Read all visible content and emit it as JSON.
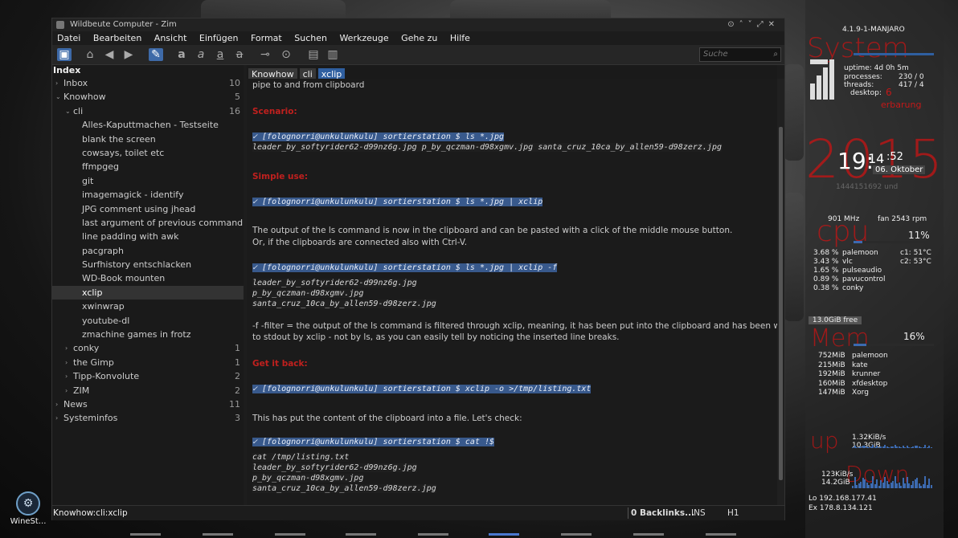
{
  "window": {
    "title": "Wildbeute Computer - Zim",
    "controls": [
      "⊙",
      "˄",
      "˅",
      "⤢",
      "✕"
    ]
  },
  "menu": [
    "Datei",
    "Bearbeiten",
    "Ansicht",
    "Einfügen",
    "Format",
    "Suchen",
    "Werkzeuge",
    "Gehe zu",
    "Hilfe"
  ],
  "toolbar": {
    "icons": [
      "notebook-icon",
      "home-icon",
      "back-icon",
      "forward-icon",
      "edit-icon",
      "bold-icon",
      "italic-icon",
      "underline-icon",
      "strike-icon",
      "link-icon",
      "attach-icon",
      "table-icon",
      "clipboard-icon"
    ],
    "search_placeholder": "Suche"
  },
  "sidebar": {
    "header": "Index",
    "nodes": [
      {
        "label": "Inbox",
        "count": "10",
        "level": 0,
        "arrow": "›"
      },
      {
        "label": "Knowhow",
        "count": "5",
        "level": 0,
        "arrow": "⌄"
      },
      {
        "label": "cli",
        "count": "16",
        "level": 1,
        "arrow": "⌄"
      },
      {
        "label": "Alles-Kaputtmachen - Testseite",
        "count": "",
        "level": 2,
        "arrow": ""
      },
      {
        "label": "blank the screen",
        "count": "",
        "level": 2,
        "arrow": ""
      },
      {
        "label": "cowsays, toilet etc",
        "count": "",
        "level": 2,
        "arrow": ""
      },
      {
        "label": "ffmpgeg",
        "count": "",
        "level": 2,
        "arrow": ""
      },
      {
        "label": "git",
        "count": "",
        "level": 2,
        "arrow": ""
      },
      {
        "label": "imagemagick - identify",
        "count": "",
        "level": 2,
        "arrow": ""
      },
      {
        "label": "JPG comment using jhead",
        "count": "",
        "level": 2,
        "arrow": ""
      },
      {
        "label": "last argument of previous command",
        "count": "",
        "level": 2,
        "arrow": ""
      },
      {
        "label": "line padding with awk",
        "count": "",
        "level": 2,
        "arrow": ""
      },
      {
        "label": "pacgraph",
        "count": "",
        "level": 2,
        "arrow": ""
      },
      {
        "label": "Surfhistory entschlacken",
        "count": "",
        "level": 2,
        "arrow": ""
      },
      {
        "label": "WD-Book mounten",
        "count": "",
        "level": 2,
        "arrow": ""
      },
      {
        "label": "xclip",
        "count": "",
        "level": 2,
        "arrow": "",
        "selected": true
      },
      {
        "label": "xwinwrap",
        "count": "",
        "level": 2,
        "arrow": ""
      },
      {
        "label": "youtube-dl",
        "count": "",
        "level": 2,
        "arrow": ""
      },
      {
        "label": "zmachine games in frotz",
        "count": "",
        "level": 2,
        "arrow": ""
      },
      {
        "label": "conky",
        "count": "1",
        "level": 1,
        "arrow": "›"
      },
      {
        "label": "the Gimp",
        "count": "1",
        "level": 1,
        "arrow": "›"
      },
      {
        "label": "Tipp-Konvolute",
        "count": "2",
        "level": 1,
        "arrow": "›"
      },
      {
        "label": "ZIM",
        "count": "2",
        "level": 1,
        "arrow": "›"
      },
      {
        "label": "News",
        "count": "11",
        "level": 0,
        "arrow": "›"
      },
      {
        "label": "Systeminfos",
        "count": "3",
        "level": 0,
        "arrow": "›"
      }
    ]
  },
  "pathbar": [
    "Knowhow",
    "cli",
    "xclip"
  ],
  "editor": {
    "lines": [
      {
        "kind": "text",
        "text": "pipe to and from clipboard"
      },
      {
        "kind": "head",
        "text": "Scenario:"
      },
      {
        "kind": "cmd",
        "text": "✓ [folognorri@unkulunkulu]  sortierstation $ ls *.jpg"
      },
      {
        "kind": "out",
        "text": "leader_by_softyrider62-d99nz6g.jpg  p_by_qczman-d98xgmv.jpg  santa_cruz_10ca_by_allen59-d98zerz.jpg"
      },
      {
        "kind": "head",
        "text": "Simple use:"
      },
      {
        "kind": "cmd",
        "text": "✓ [folognorri@unkulunkulu]  sortierstation $ ls *.jpg | xclip"
      },
      {
        "kind": "text",
        "text": "The output of the ls command is now in the clipboard and can be pasted with a click of the middle mouse button."
      },
      {
        "kind": "text",
        "text": "Or, if the clipboards are connected also with Ctrl-V."
      },
      {
        "kind": "cmd",
        "text": "✓ [folognorri@unkulunkulu]  sortierstation $ ls *.jpg | xclip -f"
      },
      {
        "kind": "out",
        "text": "leader_by_softyrider62-d99nz6g.jpg"
      },
      {
        "kind": "out",
        "text": "p_by_qczman-d98xgmv.jpg"
      },
      {
        "kind": "out",
        "text": "santa_cruz_10ca_by_allen59-d98zerz.jpg"
      },
      {
        "kind": "text",
        "text": "-f  -filter = the output of the ls command is filtered through xclip, meaning, it has been put into the clipboard and has been written"
      },
      {
        "kind": "text",
        "text": "to stdout by xclip - not by ls, as you can easily tell by noticing the inserted line breaks."
      },
      {
        "kind": "head",
        "text": "Get it back:"
      },
      {
        "kind": "cmd",
        "text": "✓ [folognorri@unkulunkulu]  sortierstation $ xclip -o >/tmp/listing.txt"
      },
      {
        "kind": "text",
        "text": "This has put the content of the clipboard into a file. Let's check:"
      },
      {
        "kind": "cmd",
        "text": "✓ [folognorri@unkulunkulu]  sortierstation $ cat !$"
      },
      {
        "kind": "out",
        "text": "cat /tmp/listing.txt"
      },
      {
        "kind": "out",
        "text": "leader_by_softyrider62-d99nz6g.jpg"
      },
      {
        "kind": "out",
        "text": "p_by_qczman-d98xgmv.jpg"
      },
      {
        "kind": "out",
        "text": "santa_cruz_10ca_by_allen59-d98zerz.jpg"
      }
    ]
  },
  "statusbar": {
    "path": "Knowhow:cli:xclip",
    "backlinks": "0 Backlinks...",
    "mode": "INS",
    "style": "H1"
  },
  "desktop_icon": {
    "label": "WineSt..."
  },
  "conky": {
    "kernel": "4.1.9-1-MANJARO",
    "system_title": "System",
    "uptime": "uptime: 4d 0h 5m",
    "processes": "processes:",
    "processes_val": "230 / 0",
    "threads": "threads:",
    "threads_val": "417 / 4",
    "desktop": "desktop:",
    "desktop_num": "6",
    "desktop_name": "erbarung",
    "year": "2015",
    "time_hm": "19:",
    "time_m": "14",
    "time_s": ":52",
    "date": "06. Oktober",
    "dim_line": "1444151692   und",
    "cpu_title": "cpu",
    "freq": "901 MHz",
    "fan": "fan 2543 rpm",
    "cpu_pct": "11%",
    "cpu_pct_value": 11,
    "procs": [
      {
        "pct": "3.68 %",
        "name": "palemoon"
      },
      {
        "pct": "3.43 %",
        "name": "vlc"
      },
      {
        "pct": "1.65 %",
        "name": "pulseaudio"
      },
      {
        "pct": "0.89 %",
        "name": "pavucontrol"
      },
      {
        "pct": "0.38 %",
        "name": "conky"
      }
    ],
    "temps": [
      "c1:   51°C",
      "c2:  53°C"
    ],
    "mem_free": "13.0GiB free",
    "mem_title": "Mem",
    "mem_pct": "16%",
    "mem_pct_value": 16,
    "mem_procs": [
      {
        "size": "752MiB",
        "name": "palemoon"
      },
      {
        "size": "215MiB",
        "name": "kate"
      },
      {
        "size": "192MiB",
        "name": "krunner"
      },
      {
        "size": "160MiB",
        "name": "xfdesktop"
      },
      {
        "size": "147MiB",
        "name": "Xorg"
      }
    ],
    "up_title": "up",
    "up_rate": "1.32KiB/s",
    "up_total": "10.3GiB",
    "down_title": "Down",
    "down_rate": "123KiB/s",
    "down_total": "14.2GiB",
    "ip_lo": "Lo 192.168.177.41",
    "ip_ex": "Ex 178.8.134.121"
  }
}
